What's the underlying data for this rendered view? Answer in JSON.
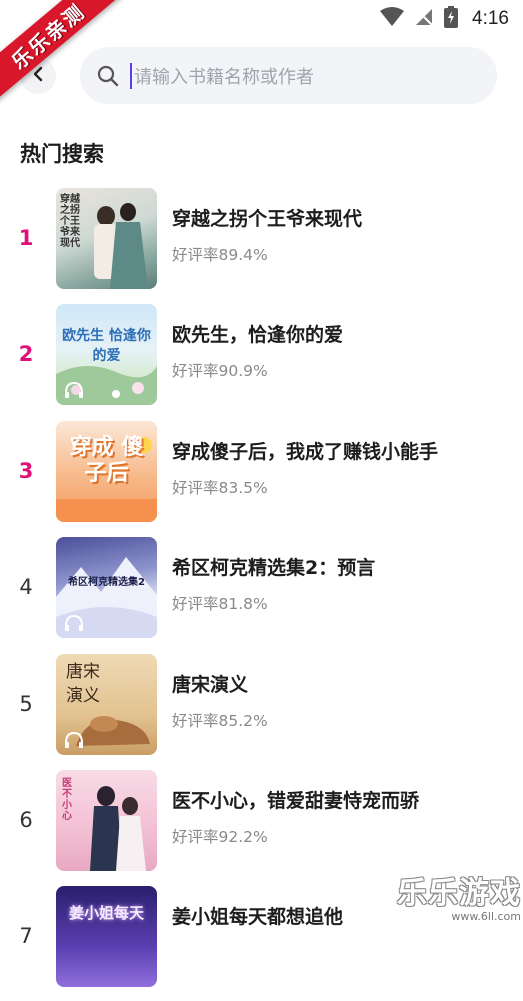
{
  "status_bar": {
    "time": "4:16"
  },
  "ribbon": {
    "text": "乐乐亲测"
  },
  "search": {
    "placeholder": "请输入书籍名称或作者"
  },
  "section": {
    "title": "热门搜索"
  },
  "books": [
    {
      "rank": "1",
      "title": "穿越之拐个王爷来现代",
      "rating": "好评率89.4%",
      "cover_text": "穿越之拐个王爷来现代"
    },
    {
      "rank": "2",
      "title": "欧先生，恰逢你的爱",
      "rating": "好评率90.9%",
      "cover_text": "欧先生 恰逢你的爱"
    },
    {
      "rank": "3",
      "title": "穿成傻子后，我成了赚钱小能手",
      "rating": "好评率83.5%",
      "cover_text": "穿成 傻子后"
    },
    {
      "rank": "4",
      "title": "希区柯克精选集2：预言",
      "rating": "好评率81.8%",
      "cover_text": "希区柯克精选集2"
    },
    {
      "rank": "5",
      "title": "唐宋演义",
      "rating": "好评率85.2%",
      "cover_text": "唐宋 演义"
    },
    {
      "rank": "6",
      "title": "医不小心，错爱甜妻恃宠而骄",
      "rating": "好评率92.2%",
      "cover_text": "医不小心"
    },
    {
      "rank": "7",
      "title": "姜小姐每天都想追他",
      "rating": "",
      "cover_text": "姜小姐每天"
    }
  ],
  "watermark": {
    "title": "乐乐游戏",
    "url": "www.6ll.com"
  },
  "colors": {
    "accent": "#5b3df5",
    "top_rank": "#e0107a",
    "ribbon": "#d8182a"
  }
}
